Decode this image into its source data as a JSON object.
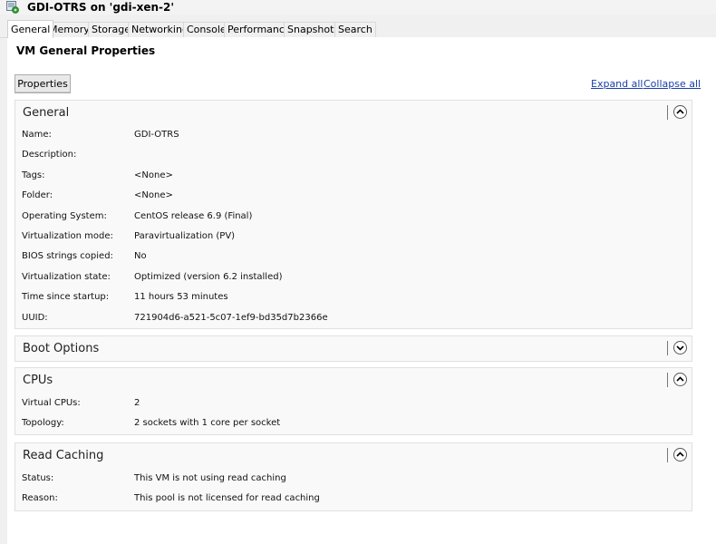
{
  "window": {
    "title": "GDI-OTRS on 'gdi-xen-2'",
    "icon": "vm-running-icon"
  },
  "tabs": [
    "General",
    "Memory",
    "Storage",
    "Networking",
    "Console",
    "Performance",
    "Snapshots",
    "Search"
  ],
  "active_tab": "General",
  "page": {
    "title": "VM General Properties",
    "properties_button": "Properties",
    "expand_all": "Expand all",
    "collapse_all": "Collapse all"
  },
  "sections": {
    "general": {
      "title": "General",
      "expanded": true,
      "rows": [
        {
          "label": "Name:",
          "value": "GDI-OTRS"
        },
        {
          "label": "Description:",
          "value": ""
        },
        {
          "label": "Tags:",
          "value": "<None>"
        },
        {
          "label": "Folder:",
          "value": "<None>"
        },
        {
          "label": "Operating System:",
          "value": "CentOS release 6.9 (Final)"
        },
        {
          "label": "Virtualization mode:",
          "value": "Paravirtualization (PV)"
        },
        {
          "label": "BIOS strings copied:",
          "value": "No"
        },
        {
          "label": "Virtualization state:",
          "value": "Optimized (version 6.2 installed)"
        },
        {
          "label": "Time since startup:",
          "value": "11 hours 53 minutes"
        },
        {
          "label": "UUID:",
          "value": "721904d6-a521-5c07-1ef9-bd35d7b2366e"
        }
      ]
    },
    "boot": {
      "title": "Boot Options",
      "expanded": false
    },
    "cpus": {
      "title": "CPUs",
      "expanded": true,
      "rows": [
        {
          "label": "Virtual CPUs:",
          "value": "2"
        },
        {
          "label": "Topology:",
          "value": "2 sockets with 1 core per socket"
        }
      ]
    },
    "caching": {
      "title": "Read Caching",
      "expanded": true,
      "rows": [
        {
          "label": "Status:",
          "value": "This VM is not using read caching"
        },
        {
          "label": "Reason:",
          "value": "This pool is not licensed for read caching"
        }
      ]
    }
  },
  "colors": {
    "link": "#1a3fa8",
    "section_bg": "#f9f9f9",
    "icon_green": "#2e9a2e"
  }
}
